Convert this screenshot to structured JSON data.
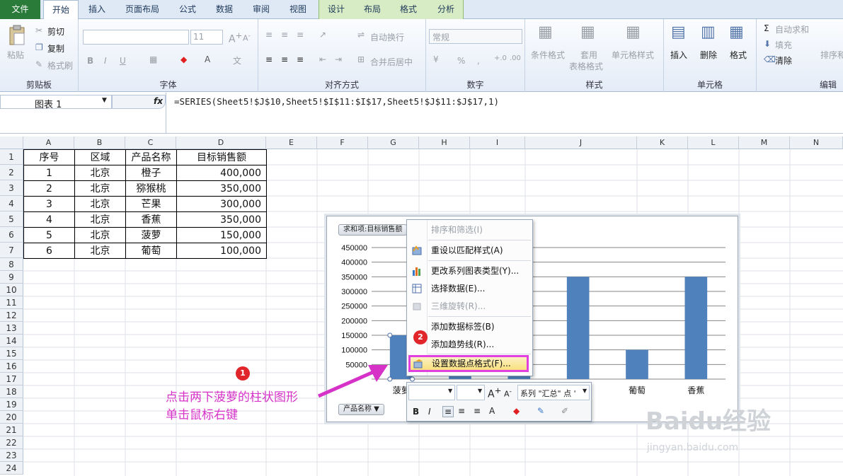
{
  "tabs": [
    "文件",
    "开始",
    "插入",
    "页面布局",
    "公式",
    "数据",
    "审阅",
    "视图",
    "设计",
    "布局",
    "格式",
    "分析"
  ],
  "ribbon": {
    "paste": "粘贴",
    "cut": "剪切",
    "copy": "复制",
    "format_painter": "格式刷",
    "clipboard": "剪贴板",
    "font_size": "11",
    "font_group": "字体",
    "bold": "B",
    "italic": "I",
    "underline": "U",
    "wrap_text": "自动换行",
    "merge_center": "合并后居中",
    "align_group": "对齐方式",
    "number_format": "常规",
    "percent": "%",
    "comma": ",",
    "number_group": "数字",
    "cond_format": "条件格式",
    "table_format_1": "套用",
    "table_format_2": "表格格式",
    "cell_styles": "单元格样式",
    "styles_group": "样式",
    "insert": "插入",
    "delete": "删除",
    "format": "格式",
    "cells_group": "单元格",
    "autosum": "自动求和",
    "fill": "填充",
    "clear": "清除",
    "sort_filter": "排序和",
    "edit_group": "编辑"
  },
  "formula_bar": {
    "name_box": "图表 1",
    "fx": "fx",
    "formula": "=SERIES(Sheet5!$J$10,Sheet5!$I$11:$I$17,Sheet5!$J$11:$J$17,1)"
  },
  "columns": [
    "A",
    "B",
    "C",
    "D",
    "E",
    "F",
    "G",
    "H",
    "I",
    "J",
    "K",
    "L",
    "M",
    "N"
  ],
  "rows": [
    "1",
    "2",
    "3",
    "4",
    "5",
    "6",
    "7",
    "8",
    "9",
    "10",
    "11",
    "12",
    "13",
    "14",
    "15",
    "16",
    "17",
    "18",
    "19",
    "20",
    "21",
    "22",
    "23",
    "24"
  ],
  "table": {
    "headers": [
      "序号",
      "区域",
      "产品名称",
      "目标销售额"
    ],
    "rows": [
      [
        "1",
        "北京",
        "橙子",
        "400,000"
      ],
      [
        "2",
        "北京",
        "猕猴桃",
        "350,000"
      ],
      [
        "3",
        "北京",
        "芒果",
        "300,000"
      ],
      [
        "4",
        "北京",
        "香蕉",
        "350,000"
      ],
      [
        "5",
        "北京",
        "菠萝",
        "150,000"
      ],
      [
        "6",
        "北京",
        "葡萄",
        "100,000"
      ]
    ]
  },
  "chart_data": {
    "type": "bar",
    "field_button": "求和项:目标销售额",
    "axis_field_button": "产品名称",
    "categories": [
      "菠萝",
      "",
      "",
      "",
      "葡萄",
      "香蕉"
    ],
    "values": [
      150000,
      350000,
      350000,
      350000,
      100000,
      350000
    ],
    "ylim": [
      0,
      450000
    ],
    "yticks": [
      "50000",
      "100000",
      "150000",
      "200000",
      "250000",
      "300000",
      "350000",
      "400000",
      "450000"
    ],
    "bar_color": "#4f81bd"
  },
  "context_menu": {
    "items": [
      {
        "label": "排序和筛选(I)",
        "disabled": true,
        "icon": ""
      },
      {
        "label": "重设以匹配样式(A)",
        "disabled": false,
        "icon": "reset-style-icon"
      },
      {
        "label": "更改系列图表类型(Y)...",
        "disabled": false,
        "icon": "chart-type-icon"
      },
      {
        "label": "选择数据(E)...",
        "disabled": false,
        "icon": "select-data-icon"
      },
      {
        "label": "三维旋转(R)...",
        "disabled": true,
        "icon": "rotate-3d-icon"
      },
      {
        "label": "添加数据标签(B)",
        "disabled": false,
        "icon": ""
      },
      {
        "label": "添加趋势线(R)...",
        "disabled": false,
        "icon": ""
      },
      {
        "label": "设置数据点格式(F)...",
        "disabled": false,
        "icon": "format-point-icon"
      }
    ]
  },
  "mini_toolbar": {
    "series_select": "系列 \"汇总\" 点 '",
    "bold": "B",
    "italic": "I",
    "grow": "A",
    "shrink": "A"
  },
  "annotation": {
    "line1": "点击两下菠萝的柱状图形",
    "line2": "单击鼠标右键",
    "badge1": "1",
    "badge2": "2"
  },
  "watermark": {
    "brand": "Baidu经验",
    "url": "jingyan.baidu.com"
  },
  "colors": {
    "highlight": "#e040e0",
    "file_tab": "#2a7a3a",
    "annot": "#d632c8"
  }
}
